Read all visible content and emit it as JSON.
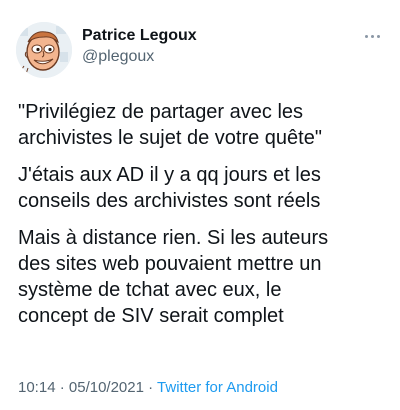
{
  "tweet": {
    "author": {
      "display_name": "Patrice Legoux",
      "handle": "@plegoux"
    },
    "more_icon": "more-horizontal-icon",
    "paragraphs": [
      "\"Privilégiez de partager avec les\narchivistes le sujet de votre quête\"",
      "J'étais aux AD il y a qq jours et les\nconseils des archivistes sont réels",
      "Mais à distance rien. Si les auteurs\ndes sites web pouvaient mettre un\nsystème de tchat avec eux, le\nconcept de SIV serait complet"
    ],
    "meta": {
      "time": "10:14",
      "separator": "·",
      "date": "05/10/2021",
      "source": "Twitter for Android"
    }
  },
  "colors": {
    "text": "#0f1419",
    "secondary": "#536471",
    "link": "#1d9bf0",
    "avatar_face": "#f3b58f"
  }
}
